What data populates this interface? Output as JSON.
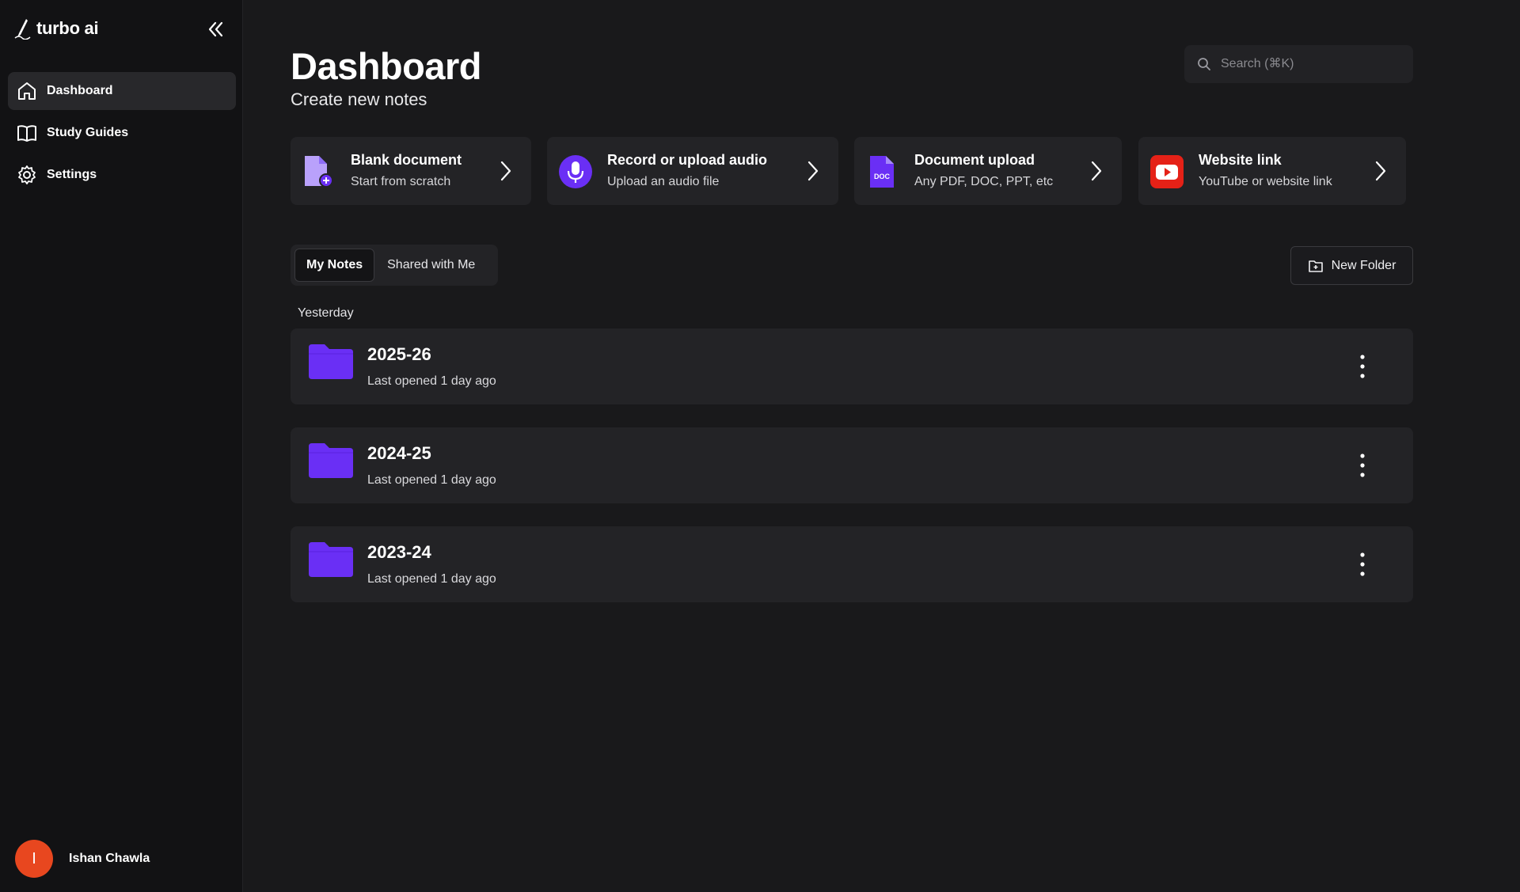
{
  "app": {
    "name": "turbo ai"
  },
  "sidebar": {
    "items": [
      {
        "label": "Dashboard",
        "icon": "home-icon",
        "active": true
      },
      {
        "label": "Study Guides",
        "icon": "book-icon",
        "active": false
      },
      {
        "label": "Settings",
        "icon": "gear-icon",
        "active": false
      }
    ],
    "user": {
      "name": "Ishan Chawla",
      "initial": "I",
      "avatar_color": "#e8471f"
    }
  },
  "header": {
    "title": "Dashboard",
    "subtitle": "Create new notes",
    "search": {
      "placeholder": "Search (⌘K)",
      "value": ""
    }
  },
  "create_cards": [
    {
      "title": "Blank document",
      "subtitle": "Start from scratch",
      "icon": "blank-document-icon"
    },
    {
      "title": "Record or upload audio",
      "subtitle": "Upload an audio file",
      "icon": "microphone-icon"
    },
    {
      "title": "Document upload",
      "subtitle": "Any PDF, DOC, PPT, etc",
      "icon": "doc-file-icon",
      "icon_text": "DOC"
    },
    {
      "title": "Website link",
      "subtitle": "YouTube or website link",
      "icon": "youtube-icon"
    }
  ],
  "tabs": [
    {
      "label": "My Notes",
      "active": true
    },
    {
      "label": "Shared with Me",
      "active": false
    }
  ],
  "new_folder": {
    "label": "New Folder"
  },
  "section": {
    "label": "Yesterday"
  },
  "folders": [
    {
      "name": "2025-26",
      "meta": "Last opened 1 day ago"
    },
    {
      "name": "2024-25",
      "meta": "Last opened 1 day ago"
    },
    {
      "name": "2023-24",
      "meta": "Last opened 1 day ago"
    }
  ],
  "colors": {
    "accent": "#6a2ff5",
    "youtube_red": "#e52117",
    "background": "#19191b",
    "sidebar": "#121214",
    "card": "#232326"
  }
}
